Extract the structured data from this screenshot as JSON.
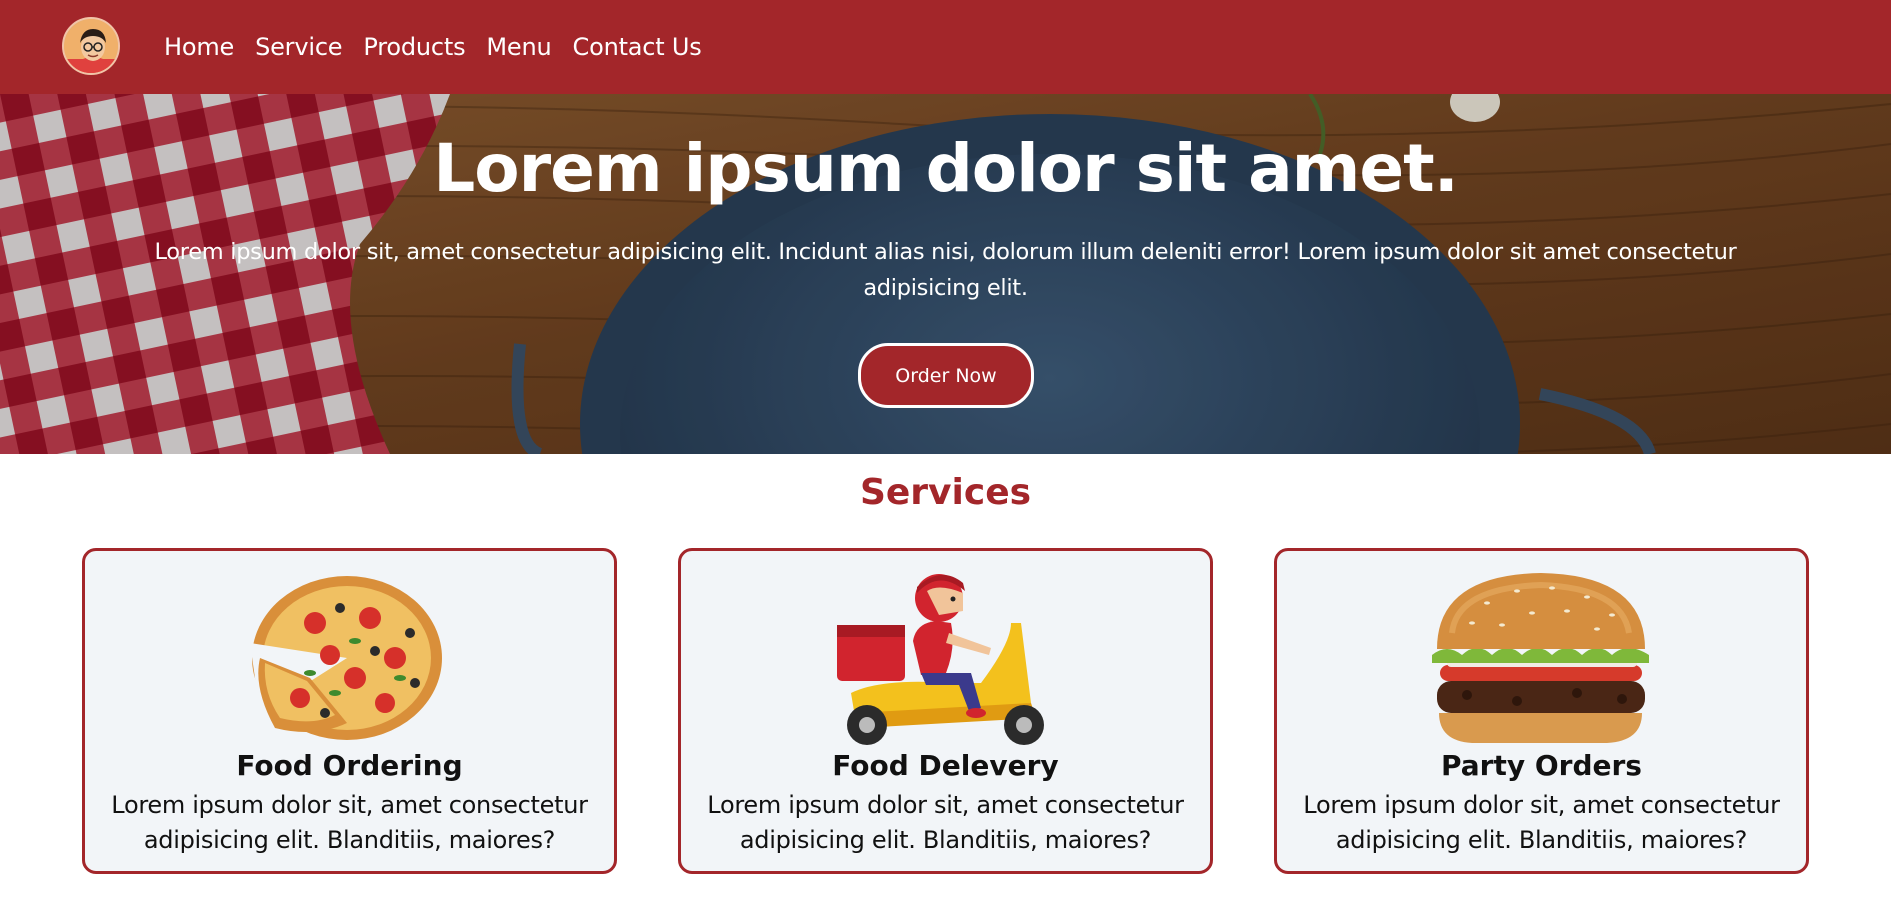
{
  "nav": {
    "items": [
      {
        "label": "Home"
      },
      {
        "label": "Service"
      },
      {
        "label": "Products"
      },
      {
        "label": "Menu"
      },
      {
        "label": "Contact Us"
      }
    ]
  },
  "hero": {
    "title": "Lorem ipsum dolor sit amet.",
    "subtitle": "Lorem ipsum dolor sit, amet consectetur adipisicing elit. Incidunt alias nisi, dolorum illum deleniti error! Lorem ipsum dolor sit amet consectetur adipisicing elit.",
    "button_label": "Order Now"
  },
  "services": {
    "title": "Services",
    "cards": [
      {
        "title": "Food Ordering",
        "text": "Lorem ipsum dolor sit, amet consectetur adipisicing elit. Blanditiis, maiores?",
        "icon": "pizza-icon"
      },
      {
        "title": "Food Delevery",
        "text": "Lorem ipsum dolor sit, amet consectetur adipisicing elit. Blanditiis, maiores?",
        "icon": "delivery-scooter-icon"
      },
      {
        "title": "Party Orders",
        "text": "Lorem ipsum dolor sit, amet consectetur adipisicing elit. Blanditiis, maiores?",
        "icon": "burger-icon"
      }
    ]
  },
  "colors": {
    "brand": "#a3262a",
    "card_bg": "#f2f5f8",
    "white": "#ffffff"
  }
}
